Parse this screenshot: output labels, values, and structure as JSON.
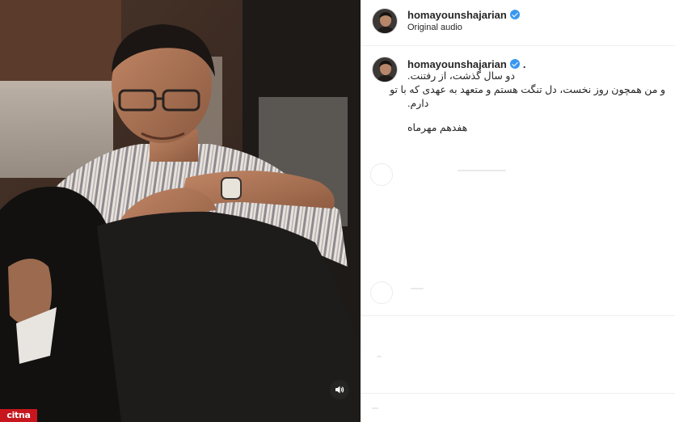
{
  "post": {
    "header": {
      "username": "homayounshajarian",
      "subtitle": "Original audio"
    },
    "caption": {
      "username": "homayounshajarian",
      "dot": ".",
      "line1": "دو سال گذشت، از رفتنت.",
      "line2": "و من همچون روز نخست، دل تنگت هستم و متعهد به عهدی که با تو",
      "line3": "دارم.",
      "line4": "هفدهم مهرماه"
    },
    "media": {
      "audio_icon": "speaker-icon",
      "watermark": "citna"
    }
  },
  "colors": {
    "verified": "#3897f0",
    "watermark_bg": "#c7161d",
    "divider": "#efefef"
  }
}
